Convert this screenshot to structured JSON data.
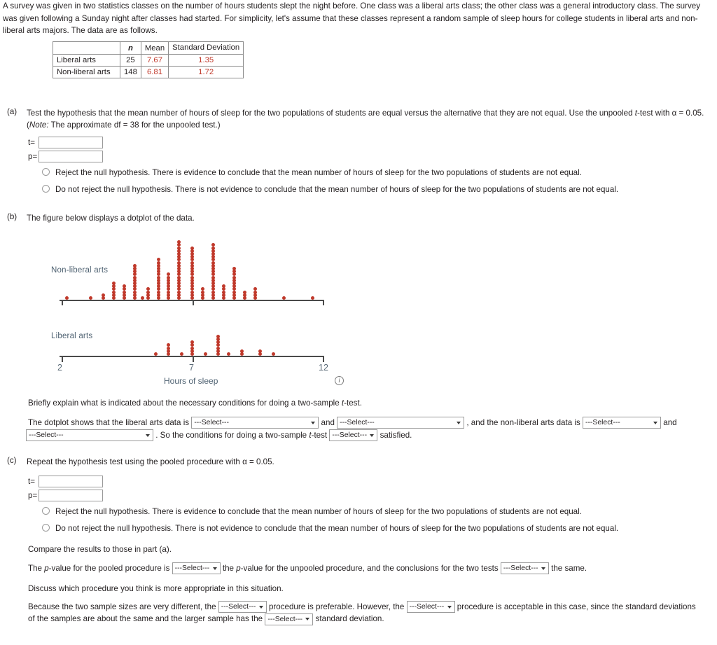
{
  "intro": "A survey was given in two statistics classes on the number of hours students slept the night before. One class was a liberal arts class; the other class was a general introductory class. The survey was given following a Sunday night after classes had started. For simplicity, let's assume that these classes represent a random sample of sleep hours for college students in liberal arts and non-liberal arts majors. The data are as follows.",
  "table": {
    "headers": [
      "",
      "n",
      "Mean",
      "Standard Deviation"
    ],
    "rows": [
      {
        "label": "Liberal arts",
        "n": "25",
        "mean": "7.67",
        "sd": "1.35"
      },
      {
        "label": "Non-liberal arts",
        "n": "148",
        "mean": "6.81",
        "sd": "1.72"
      }
    ]
  },
  "parts": {
    "a": {
      "marker": "(a)",
      "text_1": "Test the hypothesis that the mean number of hours of sleep for the two populations of students are equal versus the alternative that they are not equal. Use the unpooled ",
      "text_italic": "t",
      "text_2": "-test with α = 0.05. (",
      "note_italic": "Note:",
      "text_3": " The approximate df = 38 for the unpooled test.)",
      "t_label": "t=",
      "p_label": "p=",
      "t_value": "",
      "p_value": "",
      "option_reject": "Reject the null hypothesis. There is evidence to conclude that the mean number of hours of sleep for the two populations of students are not equal.",
      "option_not_reject": "Do not reject the null hypothesis. There is not evidence to conclude that the mean number of hours of sleep for the two populations of students are not equal."
    },
    "b": {
      "marker": "(b)",
      "text": "The figure below displays a dotplot of the data.",
      "explain_1": "Briefly explain what is indicated about the necessary conditions for doing a two-sample ",
      "explain_italic": "t",
      "explain_2": "-test.",
      "sentence": {
        "s1": "The dotplot shows that the liberal arts data is",
        "s2": "and",
        "s3": ", and the non-liberal arts data is",
        "s4": "and",
        "s5": ". So the conditions for doing a two-sample ",
        "s5_italic": "t",
        "s5_end": "-test",
        "s6": "satisfied."
      },
      "select_placeholder": "---Select---"
    },
    "c": {
      "marker": "(c)",
      "text_1": "Repeat the hypothesis test using the pooled procedure with α = 0.05.",
      "t_label": "t=",
      "p_label": "p=",
      "t_value": "",
      "p_value": "",
      "option_reject": "Reject the null hypothesis. There is evidence to conclude that the mean number of hours of sleep for the two populations of students are not equal.",
      "option_not_reject": "Do not reject the null hypothesis. There is not evidence to conclude that the mean number of hours of sleep for the two populations of students are not equal.",
      "compare": "Compare the results to those in part (a).",
      "pvalue_line": {
        "s1": "The ",
        "s1_italic": "p",
        "s1_end": "-value for the pooled procedure is",
        "s2": "the ",
        "s2_italic": "p",
        "s2_end": "-value for the unpooled procedure, and the conclusions for the two tests",
        "s3": "the same."
      },
      "discuss": "Discuss which procedure you think is more appropriate in this situation.",
      "because_line": {
        "s1": "Because the two sample sizes are very different, the",
        "s2": "procedure is preferable. However, the",
        "s3": "procedure is acceptable in this case, since the standard deviations of the samples are about the same and the larger sample has the",
        "s4": "standard deviation."
      },
      "select_placeholder": "---Select---"
    }
  },
  "chart_data": [
    {
      "type": "scatter",
      "name": "non-liberal-arts-dotplot",
      "title": "Non-liberal arts",
      "xlabel": "Hours of sleep",
      "xlim": [
        2,
        12
      ],
      "ticks": [
        2,
        7,
        12
      ],
      "tick_labels": [
        "",
        "",
        ""
      ],
      "dot_color": "#c0392b",
      "categories": [
        2.2,
        3.1,
        3.6,
        4.0,
        4.4,
        4.8,
        5.1,
        5.3,
        5.7,
        6.1,
        6.5,
        7.0,
        7.4,
        7.8,
        8.2,
        8.6,
        9.0,
        9.4,
        10.5,
        11.6
      ],
      "values": [
        1,
        1,
        2,
        6,
        5,
        12,
        1,
        4,
        14,
        9,
        20,
        18,
        4,
        19,
        5,
        11,
        3,
        4,
        1,
        1
      ]
    },
    {
      "type": "scatter",
      "name": "liberal-arts-dotplot",
      "title": "Liberal arts",
      "xlabel": "Hours of sleep",
      "xlim": [
        2,
        12
      ],
      "ticks": [
        2,
        7,
        12
      ],
      "tick_labels": [
        "2",
        "7",
        "12"
      ],
      "dot_color": "#c0392b",
      "categories": [
        5.6,
        6.1,
        6.6,
        7.0,
        7.5,
        8.0,
        8.4,
        8.9,
        9.6,
        10.1
      ],
      "values": [
        1,
        4,
        1,
        5,
        1,
        7,
        1,
        2,
        2,
        1
      ]
    }
  ]
}
